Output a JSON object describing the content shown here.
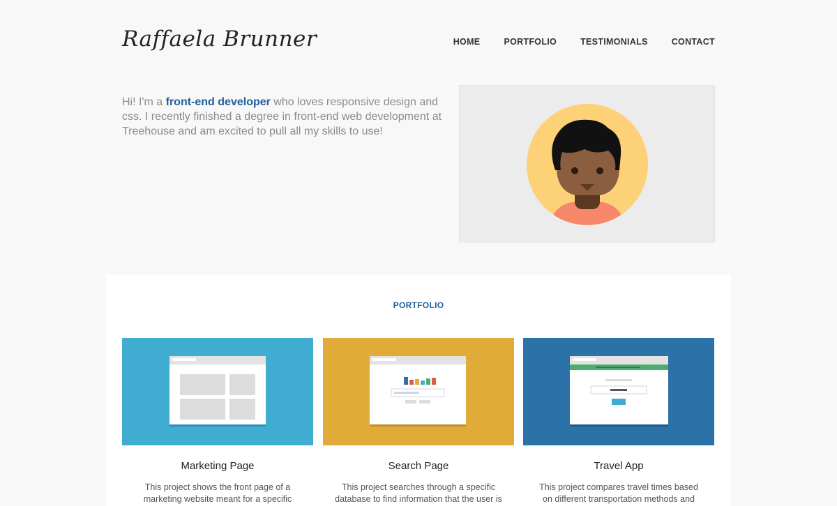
{
  "header": {
    "logo": "Raffaela Brunner",
    "nav": [
      "HOME",
      "PORTFOLIO",
      "TESTIMONIALS",
      "CONTACT"
    ]
  },
  "intro": {
    "before": "Hi! I'm a ",
    "highlight": "front-end developer",
    "after": " who loves responsive design and css. I recently finished a degree in front-end web development at Treehouse and am excited to pull all my skills to use!"
  },
  "colors": {
    "accent": "#1f5d9c",
    "marketing": "#41acd1",
    "search": "#e0ab37",
    "travel": "#2b72a8"
  },
  "portfolio": {
    "title": "PORTFOLIO",
    "cards": [
      {
        "title": "Marketing Page",
        "desc": "This project shows the front page of a marketing website meant for a specific"
      },
      {
        "title": "Search Page",
        "desc": "This project searches through a specific database to find information that the user is"
      },
      {
        "title": "Travel App",
        "desc": "This project compares travel times based on different transportation methods and tells"
      }
    ]
  }
}
